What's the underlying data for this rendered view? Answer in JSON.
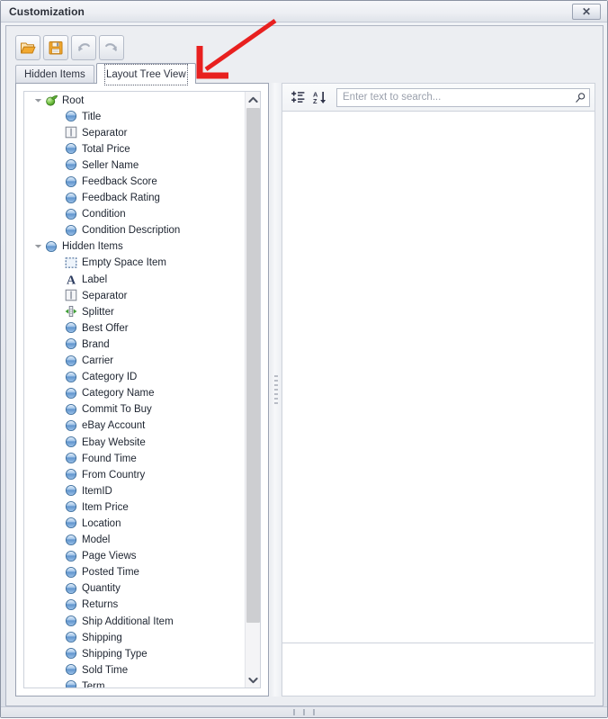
{
  "window": {
    "title": "Customization",
    "close_label": "✕"
  },
  "toolbar": {
    "buttons": [
      {
        "name": "open-layout-button",
        "icon": "open-folder-icon",
        "enabled": true
      },
      {
        "name": "save-layout-button",
        "icon": "save-floppy-icon",
        "enabled": true
      },
      {
        "name": "undo-button",
        "icon": "undo-arrow-icon",
        "enabled": false
      },
      {
        "name": "redo-button",
        "icon": "redo-arrow-icon",
        "enabled": false
      }
    ]
  },
  "tabs": [
    {
      "label": "Hidden Items",
      "active": false
    },
    {
      "label": "Layout Tree View",
      "active": true
    }
  ],
  "tree": {
    "nodes": [
      {
        "label": "Root",
        "icon": "root-node-icon",
        "level": 0,
        "expander": "expanded"
      },
      {
        "label": "Title",
        "icon": "field-item-icon",
        "level": 1,
        "expander": "none"
      },
      {
        "label": "Separator",
        "icon": "separator-icon",
        "level": 1,
        "expander": "none"
      },
      {
        "label": "Total Price",
        "icon": "field-item-icon",
        "level": 1,
        "expander": "none"
      },
      {
        "label": "Seller Name",
        "icon": "field-item-icon",
        "level": 1,
        "expander": "none"
      },
      {
        "label": "Feedback Score",
        "icon": "field-item-icon",
        "level": 1,
        "expander": "none"
      },
      {
        "label": "Feedback Rating",
        "icon": "field-item-icon",
        "level": 1,
        "expander": "none"
      },
      {
        "label": "Condition",
        "icon": "field-item-icon",
        "level": 1,
        "expander": "none"
      },
      {
        "label": "Condition Description",
        "icon": "field-item-icon",
        "level": 1,
        "expander": "none"
      },
      {
        "label": "Hidden Items",
        "icon": "field-item-icon",
        "level": 0,
        "expander": "expanded"
      },
      {
        "label": "Empty Space Item",
        "icon": "empty-space-icon",
        "level": 1,
        "expander": "none"
      },
      {
        "label": "Label",
        "icon": "label-a-icon",
        "level": 1,
        "expander": "none"
      },
      {
        "label": "Separator",
        "icon": "separator-icon",
        "level": 1,
        "expander": "none"
      },
      {
        "label": "Splitter",
        "icon": "splitter-icon",
        "level": 1,
        "expander": "none"
      },
      {
        "label": "Best Offer",
        "icon": "field-item-icon",
        "level": 1,
        "expander": "none"
      },
      {
        "label": "Brand",
        "icon": "field-item-icon",
        "level": 1,
        "expander": "none"
      },
      {
        "label": "Carrier",
        "icon": "field-item-icon",
        "level": 1,
        "expander": "none"
      },
      {
        "label": "Category ID",
        "icon": "field-item-icon",
        "level": 1,
        "expander": "none"
      },
      {
        "label": "Category Name",
        "icon": "field-item-icon",
        "level": 1,
        "expander": "none"
      },
      {
        "label": "Commit To Buy",
        "icon": "field-item-icon",
        "level": 1,
        "expander": "none"
      },
      {
        "label": "eBay Account",
        "icon": "field-item-icon",
        "level": 1,
        "expander": "none"
      },
      {
        "label": "Ebay Website",
        "icon": "field-item-icon",
        "level": 1,
        "expander": "none"
      },
      {
        "label": "Found Time",
        "icon": "field-item-icon",
        "level": 1,
        "expander": "none"
      },
      {
        "label": "From Country",
        "icon": "field-item-icon",
        "level": 1,
        "expander": "none"
      },
      {
        "label": "ItemID",
        "icon": "field-item-icon",
        "level": 1,
        "expander": "none"
      },
      {
        "label": "Item Price",
        "icon": "field-item-icon",
        "level": 1,
        "expander": "none"
      },
      {
        "label": "Location",
        "icon": "field-item-icon",
        "level": 1,
        "expander": "none"
      },
      {
        "label": "Model",
        "icon": "field-item-icon",
        "level": 1,
        "expander": "none"
      },
      {
        "label": "Page Views",
        "icon": "field-item-icon",
        "level": 1,
        "expander": "none"
      },
      {
        "label": "Posted Time",
        "icon": "field-item-icon",
        "level": 1,
        "expander": "none"
      },
      {
        "label": "Quantity",
        "icon": "field-item-icon",
        "level": 1,
        "expander": "none"
      },
      {
        "label": "Returns",
        "icon": "field-item-icon",
        "level": 1,
        "expander": "none"
      },
      {
        "label": "Ship Additional Item",
        "icon": "field-item-icon",
        "level": 1,
        "expander": "none"
      },
      {
        "label": "Shipping",
        "icon": "field-item-icon",
        "level": 1,
        "expander": "none"
      },
      {
        "label": "Shipping Type",
        "icon": "field-item-icon",
        "level": 1,
        "expander": "none"
      },
      {
        "label": "Sold Time",
        "icon": "field-item-icon",
        "level": 1,
        "expander": "none"
      },
      {
        "label": "Term",
        "icon": "field-item-icon",
        "level": 1,
        "expander": "none"
      }
    ]
  },
  "search": {
    "group_button_name": "group-by-category-icon",
    "sort_button_name": "sort-alphabetical-icon",
    "placeholder": "Enter text to search...",
    "value": "",
    "search_icon": "magnifier-icon"
  },
  "colors": {
    "annotation": "#e8201f",
    "title_text": "#2b2f38",
    "node_icon_blue": "#6f9fd8",
    "node_icon_green": "#5fae37",
    "toolbar_orange": "#e8921f"
  }
}
